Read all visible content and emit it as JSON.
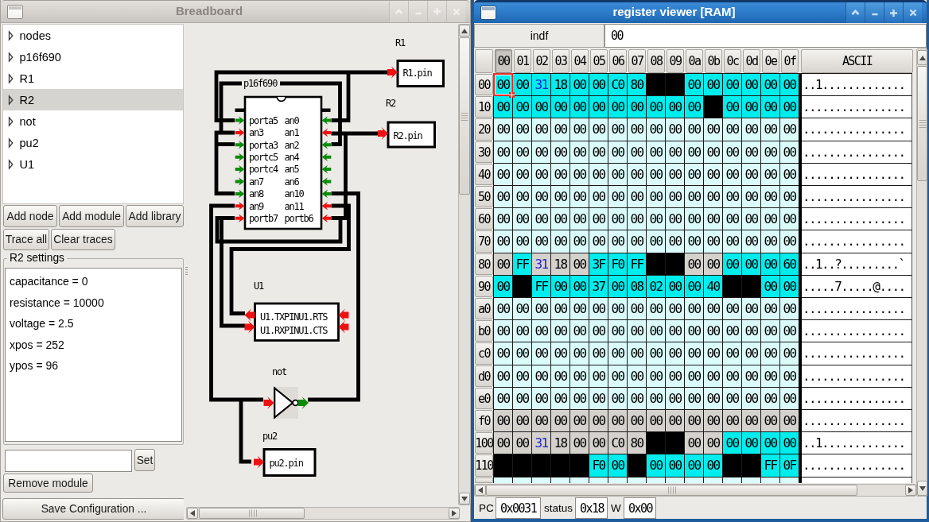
{
  "left_window": {
    "title": "Breadboard",
    "titlebar_buttons": [
      "shade",
      "minimize",
      "maximize",
      "close"
    ],
    "tree": {
      "items": [
        {
          "label": "nodes",
          "selected": false
        },
        {
          "label": "p16f690",
          "selected": false
        },
        {
          "label": "R1",
          "selected": false
        },
        {
          "label": "R2",
          "selected": true
        },
        {
          "label": "not",
          "selected": false
        },
        {
          "label": "pu2",
          "selected": false
        },
        {
          "label": "U1",
          "selected": false
        }
      ]
    },
    "buttons": {
      "add_node": "Add node",
      "add_module": "Add module",
      "add_library": "Add library",
      "trace_all": "Trace all",
      "clear_traces": "Clear traces",
      "set": "Set",
      "remove_module": "Remove module",
      "save_configuration": "Save Configuration ..."
    },
    "settings": {
      "frame_title": "R2 settings",
      "items": [
        "capacitance = 0",
        "resistance = 10000",
        "voltage = 2.5",
        "xpos = 252",
        "ypos = 96"
      ],
      "entry_value": ""
    },
    "canvas": {
      "chip": {
        "name": "p16f690",
        "left_pins": [
          {
            "label": "porta5",
            "color": "g"
          },
          {
            "label": "an3",
            "color": "r"
          },
          {
            "label": "porta3",
            "color": "g"
          },
          {
            "label": "portc5",
            "color": "g"
          },
          {
            "label": "portc4",
            "color": "g"
          },
          {
            "label": "an7",
            "color": "g"
          },
          {
            "label": "an8",
            "color": "g"
          },
          {
            "label": "an9",
            "color": "r"
          },
          {
            "label": "portb7",
            "color": "r"
          }
        ],
        "right_pins": [
          {
            "label": "an0",
            "color": "g"
          },
          {
            "label": "an1",
            "color": "r"
          },
          {
            "label": "an2",
            "color": "g"
          },
          {
            "label": "an4",
            "color": "g"
          },
          {
            "label": "an5",
            "color": "g"
          },
          {
            "label": "an6",
            "color": "g"
          },
          {
            "label": "an10",
            "color": "g"
          },
          {
            "label": "an11",
            "color": "r"
          },
          {
            "label": "portb6",
            "color": "r"
          }
        ]
      },
      "colors": {
        "high_arrow": "#0B8A0B",
        "low_arrow": "#EE1111",
        "wire": "#000000"
      },
      "labels": {
        "r1": "R1",
        "r1pin": "R1.pin",
        "r2": "R2",
        "r2pin": "R2.pin",
        "u1": "U1",
        "u1_line1": "U1.TXPINU1.RTS",
        "u1_line2": "U1.RXPINU1.CTS",
        "not": "not",
        "pu2": "pu2",
        "pu2pin": "pu2.pin"
      }
    }
  },
  "right_window": {
    "title": "register viewer [RAM]",
    "titlebar_buttons": [
      "shade",
      "minimize",
      "maximize",
      "close"
    ],
    "register_name": "indf",
    "register_value": "00",
    "sheet": {
      "colors": {
        "recently_accessed": "#00EDED",
        "ram": "#DBFBFB",
        "sfr": "#D5D2CE",
        "invalid": "#000000",
        "changed_value_text": "#2222CE",
        "cursor": "#EE2A22"
      },
      "col_headers": [
        "00",
        "01",
        "02",
        "03",
        "04",
        "05",
        "06",
        "07",
        "08",
        "09",
        "0a",
        "0b",
        "0c",
        "0d",
        "0e",
        "0f"
      ],
      "ascii_header": "ASCII",
      "selected_cell": {
        "row": 0,
        "col": 0
      },
      "rows": [
        {
          "label": "00",
          "v": [
            "00",
            "00",
            "31",
            "18",
            "00",
            "00",
            "C0",
            "80",
            "",
            "",
            "00",
            "00",
            "00",
            "00",
            "00",
            "00"
          ],
          "bg": "cccccccckkcccccc",
          "blue": [
            2
          ],
          "ascii": "..1............."
        },
        {
          "label": "10",
          "v": [
            "00",
            "00",
            "00",
            "00",
            "00",
            "00",
            "00",
            "00",
            "00",
            "00",
            "00",
            "",
            "00",
            "00",
            "00",
            "00"
          ],
          "bg": "ccccccccccckcccc",
          "blue": [],
          "ascii": "................"
        },
        {
          "label": "20",
          "v": [
            "00",
            "00",
            "00",
            "00",
            "00",
            "00",
            "00",
            "00",
            "00",
            "00",
            "00",
            "00",
            "00",
            "00",
            "00",
            "00"
          ],
          "bg": "pppppppppppppppp",
          "blue": [],
          "ascii": "................"
        },
        {
          "label": "30",
          "v": [
            "00",
            "00",
            "00",
            "00",
            "00",
            "00",
            "00",
            "00",
            "00",
            "00",
            "00",
            "00",
            "00",
            "00",
            "00",
            "00"
          ],
          "bg": "pppppppppppppppp",
          "blue": [],
          "ascii": "................"
        },
        {
          "label": "40",
          "v": [
            "00",
            "00",
            "00",
            "00",
            "00",
            "00",
            "00",
            "00",
            "00",
            "00",
            "00",
            "00",
            "00",
            "00",
            "00",
            "00"
          ],
          "bg": "pppppppppppppppp",
          "blue": [],
          "ascii": "................"
        },
        {
          "label": "50",
          "v": [
            "00",
            "00",
            "00",
            "00",
            "00",
            "00",
            "00",
            "00",
            "00",
            "00",
            "00",
            "00",
            "00",
            "00",
            "00",
            "00"
          ],
          "bg": "pppppppppppppppp",
          "blue": [],
          "ascii": "................"
        },
        {
          "label": "60",
          "v": [
            "00",
            "00",
            "00",
            "00",
            "00",
            "00",
            "00",
            "00",
            "00",
            "00",
            "00",
            "00",
            "00",
            "00",
            "00",
            "00"
          ],
          "bg": "pppppppppppppppp",
          "blue": [],
          "ascii": "................"
        },
        {
          "label": "70",
          "v": [
            "00",
            "00",
            "00",
            "00",
            "00",
            "00",
            "00",
            "00",
            "00",
            "00",
            "00",
            "00",
            "00",
            "00",
            "00",
            "00"
          ],
          "bg": "pppppppppppppppp",
          "blue": [],
          "ascii": "................"
        },
        {
          "label": "80",
          "v": [
            "00",
            "FF",
            "31",
            "18",
            "00",
            "3F",
            "F0",
            "FF",
            "",
            "",
            "00",
            "00",
            "00",
            "00",
            "00",
            "60"
          ],
          "bg": "gcgggccckkggcccc",
          "blue": [
            2
          ],
          "ascii": "..1..?.........`"
        },
        {
          "label": "90",
          "v": [
            "00",
            "",
            "FF",
            "00",
            "00",
            "37",
            "00",
            "08",
            "02",
            "00",
            "00",
            "40",
            "",
            "",
            "00",
            "00"
          ],
          "bg": "ckcccccccccckkcc",
          "blue": [],
          "ascii": ".....7.....@...."
        },
        {
          "label": "a0",
          "v": [
            "00",
            "00",
            "00",
            "00",
            "00",
            "00",
            "00",
            "00",
            "00",
            "00",
            "00",
            "00",
            "00",
            "00",
            "00",
            "00"
          ],
          "bg": "pppppppppppppppp",
          "blue": [],
          "ascii": "................"
        },
        {
          "label": "b0",
          "v": [
            "00",
            "00",
            "00",
            "00",
            "00",
            "00",
            "00",
            "00",
            "00",
            "00",
            "00",
            "00",
            "00",
            "00",
            "00",
            "00"
          ],
          "bg": "pppppppppppppppp",
          "blue": [],
          "ascii": "................"
        },
        {
          "label": "c0",
          "v": [
            "00",
            "00",
            "00",
            "00",
            "00",
            "00",
            "00",
            "00",
            "00",
            "00",
            "00",
            "00",
            "00",
            "00",
            "00",
            "00"
          ],
          "bg": "pppppppppppppppp",
          "blue": [],
          "ascii": "................"
        },
        {
          "label": "d0",
          "v": [
            "00",
            "00",
            "00",
            "00",
            "00",
            "00",
            "00",
            "00",
            "00",
            "00",
            "00",
            "00",
            "00",
            "00",
            "00",
            "00"
          ],
          "bg": "pppppppppppppppp",
          "blue": [],
          "ascii": "................"
        },
        {
          "label": "e0",
          "v": [
            "00",
            "00",
            "00",
            "00",
            "00",
            "00",
            "00",
            "00",
            "00",
            "00",
            "00",
            "00",
            "00",
            "00",
            "00",
            "00"
          ],
          "bg": "pppppppppppppppp",
          "blue": [],
          "ascii": "................"
        },
        {
          "label": "f0",
          "v": [
            "00",
            "00",
            "00",
            "00",
            "00",
            "00",
            "00",
            "00",
            "00",
            "00",
            "00",
            "00",
            "00",
            "00",
            "00",
            "00"
          ],
          "bg": "gggggggggggggggg",
          "blue": [],
          "ascii": "................"
        },
        {
          "label": "100",
          "v": [
            "00",
            "00",
            "31",
            "18",
            "00",
            "00",
            "C0",
            "80",
            "",
            "",
            "00",
            "00",
            "00",
            "00",
            "00",
            "00"
          ],
          "bg": "ggggggggkkggcccc",
          "blue": [
            2
          ],
          "ascii": "..1............."
        },
        {
          "label": "110",
          "v": [
            "",
            "",
            "",
            "",
            "",
            "F0",
            "00",
            "",
            "00",
            "00",
            "00",
            "00",
            "",
            "",
            "FF",
            "0F"
          ],
          "bg": "kkkkkcckcccckkcc",
          "blue": [],
          "ascii": "................"
        }
      ]
    },
    "status": {
      "pc_label": "PC",
      "pc_value": "0x0031",
      "status_label": "status",
      "status_value": "0x18",
      "w_label": "W",
      "w_value": "0x00"
    }
  }
}
